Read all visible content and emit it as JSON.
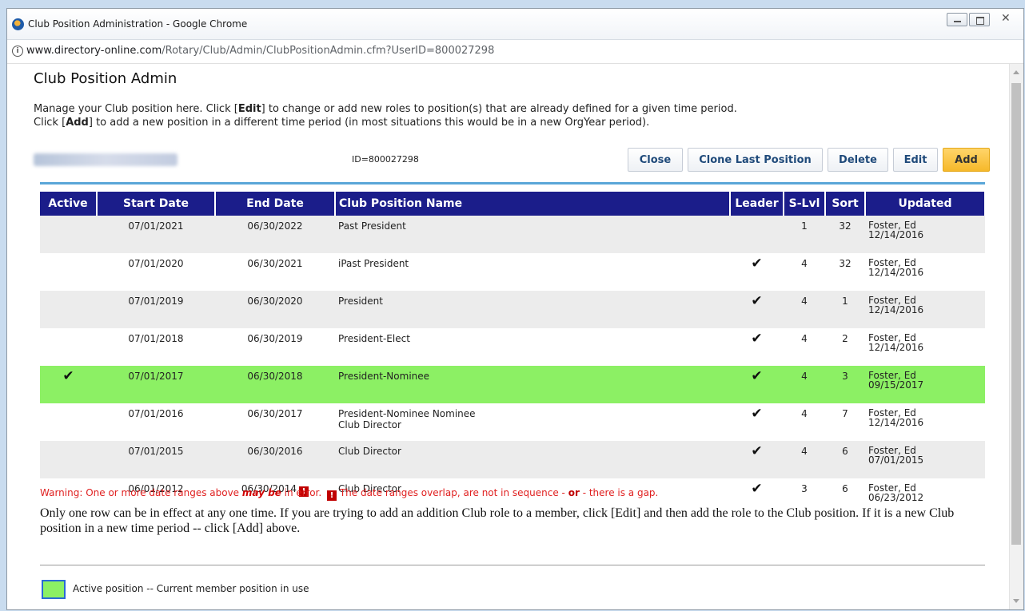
{
  "window": {
    "title": "Club Position Administration - Google Chrome",
    "url_host": "www.directory-online.com",
    "url_path": "/Rotary/Club/Admin/ClubPositionAdmin.cfm?UserID=800027298"
  },
  "page": {
    "title": "Club Position Admin",
    "intro1_a": "Manage your Club position here. Click [",
    "intro1_b": "Edit",
    "intro1_c": "] to change or add new roles to position(s) that are already defined for a given time period.",
    "intro2_a": "Click [",
    "intro2_b": "Add",
    "intro2_c": "] to add a new position in a different time period (in most situations this would be in a new OrgYear period).",
    "member_id": "ID=800027298"
  },
  "toolbar": {
    "close": "Close",
    "clone": "Clone Last Position",
    "delete": "Delete",
    "edit": "Edit",
    "add": "Add"
  },
  "table": {
    "headers": {
      "active": "Active",
      "start": "Start Date",
      "end": "End Date",
      "name": "Club Position Name",
      "leader": "Leader",
      "slvl": "S-Lvl",
      "sort": "Sort",
      "updated": "Updated"
    },
    "rows": [
      {
        "active": "",
        "start": "07/01/2021",
        "end": "06/30/2022",
        "name1": "Past President",
        "name2": "",
        "leader": "",
        "slvl": "1",
        "sort": "32",
        "upd_by": "Foster, Ed",
        "upd_date": "12/14/2016"
      },
      {
        "active": "",
        "start": "07/01/2020",
        "end": "06/30/2021",
        "name1": "iPast President",
        "name2": "",
        "leader": "✔",
        "slvl": "4",
        "sort": "32",
        "upd_by": "Foster, Ed",
        "upd_date": "12/14/2016"
      },
      {
        "active": "",
        "start": "07/01/2019",
        "end": "06/30/2020",
        "name1": "President",
        "name2": "",
        "leader": "✔",
        "slvl": "4",
        "sort": "1",
        "upd_by": "Foster, Ed",
        "upd_date": "12/14/2016"
      },
      {
        "active": "",
        "start": "07/01/2018",
        "end": "06/30/2019",
        "name1": "President-Elect",
        "name2": "",
        "leader": "✔",
        "slvl": "4",
        "sort": "2",
        "upd_by": "Foster, Ed",
        "upd_date": "12/14/2016"
      },
      {
        "active": "✔",
        "start": "07/01/2017",
        "end": "06/30/2018",
        "name1": "President-Nominee",
        "name2": "",
        "leader": "✔",
        "slvl": "4",
        "sort": "3",
        "upd_by": "Foster, Ed",
        "upd_date": "09/15/2017"
      },
      {
        "active": "",
        "start": "07/01/2016",
        "end": "06/30/2017",
        "name1": "President-Nominee Nominee",
        "name2": "Club Director",
        "leader": "✔",
        "slvl": "4",
        "sort": "7",
        "upd_by": "Foster, Ed",
        "upd_date": "12/14/2016"
      },
      {
        "active": "",
        "start": "07/01/2015",
        "end": "06/30/2016",
        "name1": "Club Director",
        "name2": "",
        "leader": "✔",
        "slvl": "4",
        "sort": "6",
        "upd_by": "Foster, Ed",
        "upd_date": "07/01/2015"
      },
      {
        "active": "",
        "start": "06/01/2012",
        "end": "06/30/2014",
        "name1": "Club Director",
        "name2": "",
        "leader": "✔",
        "slvl": "3",
        "sort": "6",
        "upd_by": "Foster, Ed",
        "upd_date": "06/23/2012"
      }
    ]
  },
  "warning": {
    "a": "Warning: One or more date ranges above ",
    "b": "may be",
    "c": " in error. ",
    "d": " The date ranges overlap, are not in sequence - ",
    "e": "or",
    "f": " - there is a gap.",
    "icon": "!"
  },
  "note": "Only one row can be in effect at any one time. If you are trying to add an addition Club role to a member, click [Edit] and then add the role to the Club position. If it is a new Club position in a new time period -- click [Add] above.",
  "legend": {
    "text": "Active position -- Current member position in use",
    "color": "#8cf064"
  },
  "colors": {
    "header_bg": "#1b1d8a",
    "active_row": "#8cf064",
    "accent_rule": "#5aa6d8",
    "add_button": "#f6b92a",
    "warning": "#e02020"
  }
}
